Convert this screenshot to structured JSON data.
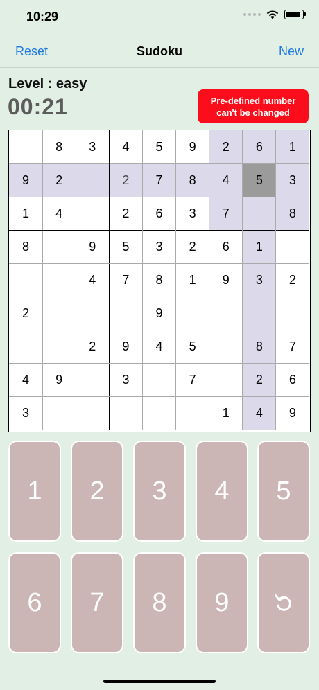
{
  "status_bar": {
    "time": "10:29"
  },
  "nav": {
    "left_label": "Reset",
    "title": "Sudoku",
    "right_label": "New"
  },
  "game": {
    "level_label": "Level : easy",
    "timer": "00:21",
    "alert_line1": "Pre-defined number",
    "alert_line2": "can't be changed"
  },
  "colors": {
    "accent": "#1f7ae0",
    "background": "#e2efe4",
    "highlight": "#dcdaea",
    "selected": "#9b9b9b",
    "alert": "#fc0d1b",
    "keypad": "#cbb5b5"
  },
  "board": {
    "selected_row": 1,
    "selected_col": 7,
    "cells": [
      [
        "",
        "8",
        "3",
        "4",
        "5",
        "9",
        "2",
        "6",
        "1"
      ],
      [
        "9",
        "2",
        "",
        "2",
        "7",
        "8",
        "4",
        "5",
        "3"
      ],
      [
        "1",
        "4",
        "",
        "2",
        "6",
        "3",
        "7",
        "",
        "8"
      ],
      [
        "8",
        "",
        "9",
        "5",
        "3",
        "2",
        "6",
        "1",
        ""
      ],
      [
        "",
        "",
        "4",
        "7",
        "8",
        "1",
        "9",
        "3",
        "2"
      ],
      [
        "2",
        "",
        "",
        "",
        "9",
        "",
        "",
        "",
        ""
      ],
      [
        "",
        "",
        "2",
        "9",
        "4",
        "5",
        "",
        "8",
        "7"
      ],
      [
        "4",
        "9",
        "",
        "3",
        "",
        "7",
        "",
        "2",
        "6"
      ],
      [
        "3",
        "",
        "",
        "",
        "",
        "",
        "1",
        "4",
        "9"
      ]
    ],
    "user_entered": [
      [
        1,
        3
      ]
    ]
  },
  "keypad": {
    "keys": [
      "1",
      "2",
      "3",
      "4",
      "5",
      "6",
      "7",
      "8",
      "9"
    ],
    "undo_icon": "undo-icon"
  }
}
